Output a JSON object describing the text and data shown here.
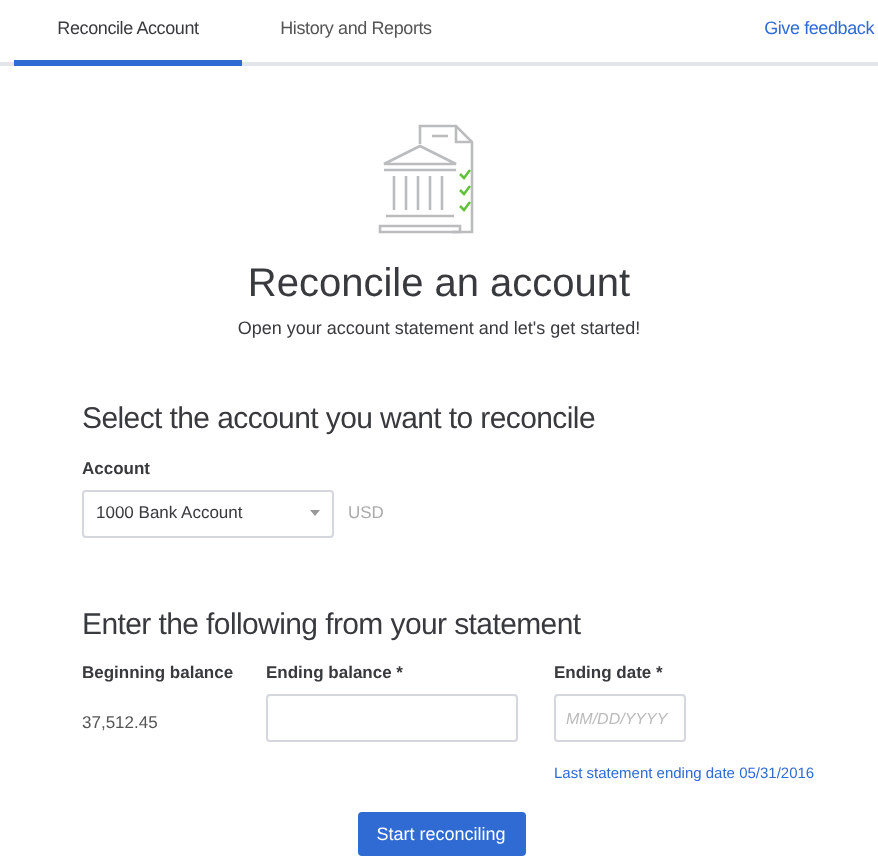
{
  "tabs": [
    {
      "label": "Reconcile Account",
      "selected": true
    },
    {
      "label": "History and Reports",
      "selected": false
    }
  ],
  "feedback_link": "Give feedback",
  "title": "Reconcile an account",
  "subtitle": "Open your account statement and let's get started!",
  "account_section": {
    "heading": "Select the account you want to reconcile",
    "label": "Account",
    "value": "1000 Bank Account",
    "currency": "USD"
  },
  "statement_section": {
    "heading": "Enter the following from your statement",
    "beginning_balance": {
      "label": "Beginning balance",
      "value": "37,512.45"
    },
    "ending_balance": {
      "label": "Ending balance *"
    },
    "ending_date": {
      "label": "Ending date *",
      "placeholder": "MM/DD/YYYY"
    },
    "last_statement_link": "Last statement ending date 05/31/2016"
  },
  "primary_button": "Start reconciling"
}
